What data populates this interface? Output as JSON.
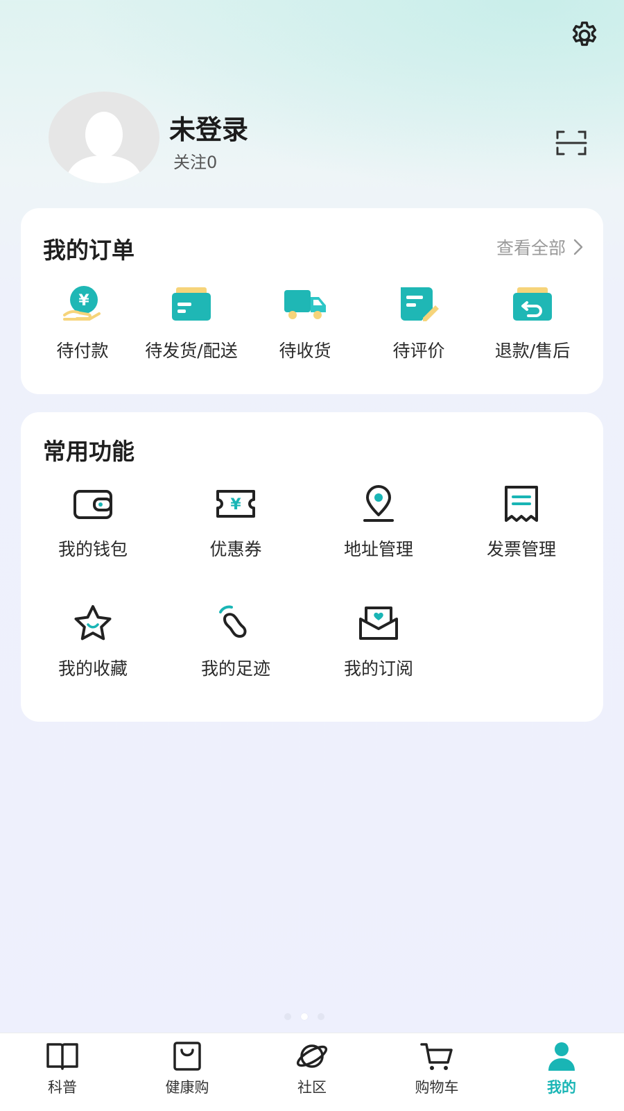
{
  "profile": {
    "name": "未登录",
    "follow": "关注0"
  },
  "orders": {
    "title": "我的订单",
    "view_all": "查看全部",
    "items": [
      {
        "label": "待付款",
        "icon": "yuan-hand-icon"
      },
      {
        "label": "待发货/配送",
        "icon": "box-icon"
      },
      {
        "label": "待收货",
        "icon": "truck-icon"
      },
      {
        "label": "待评价",
        "icon": "review-pen-icon"
      },
      {
        "label": "退款/售后",
        "icon": "return-box-icon"
      }
    ]
  },
  "functions": {
    "title": "常用功能",
    "items": [
      {
        "label": "我的钱包",
        "icon": "wallet-icon"
      },
      {
        "label": "优惠券",
        "icon": "coupon-icon"
      },
      {
        "label": "地址管理",
        "icon": "location-pin-icon"
      },
      {
        "label": "发票管理",
        "icon": "invoice-icon"
      },
      {
        "label": "我的收藏",
        "icon": "star-icon"
      },
      {
        "label": "我的足迹",
        "icon": "footprint-icon"
      },
      {
        "label": "我的订阅",
        "icon": "mail-heart-icon"
      }
    ]
  },
  "tabs": [
    {
      "label": "科普",
      "icon": "book-icon"
    },
    {
      "label": "健康购",
      "icon": "shopping-bag-icon"
    },
    {
      "label": "社区",
      "icon": "planet-icon"
    },
    {
      "label": "购物车",
      "icon": "cart-icon"
    },
    {
      "label": "我的",
      "icon": "person-icon",
      "active": true
    }
  ],
  "colors": {
    "accent": "#19b5b5",
    "accent_light": "#2cc6c6",
    "highlight": "#f6d47a"
  }
}
